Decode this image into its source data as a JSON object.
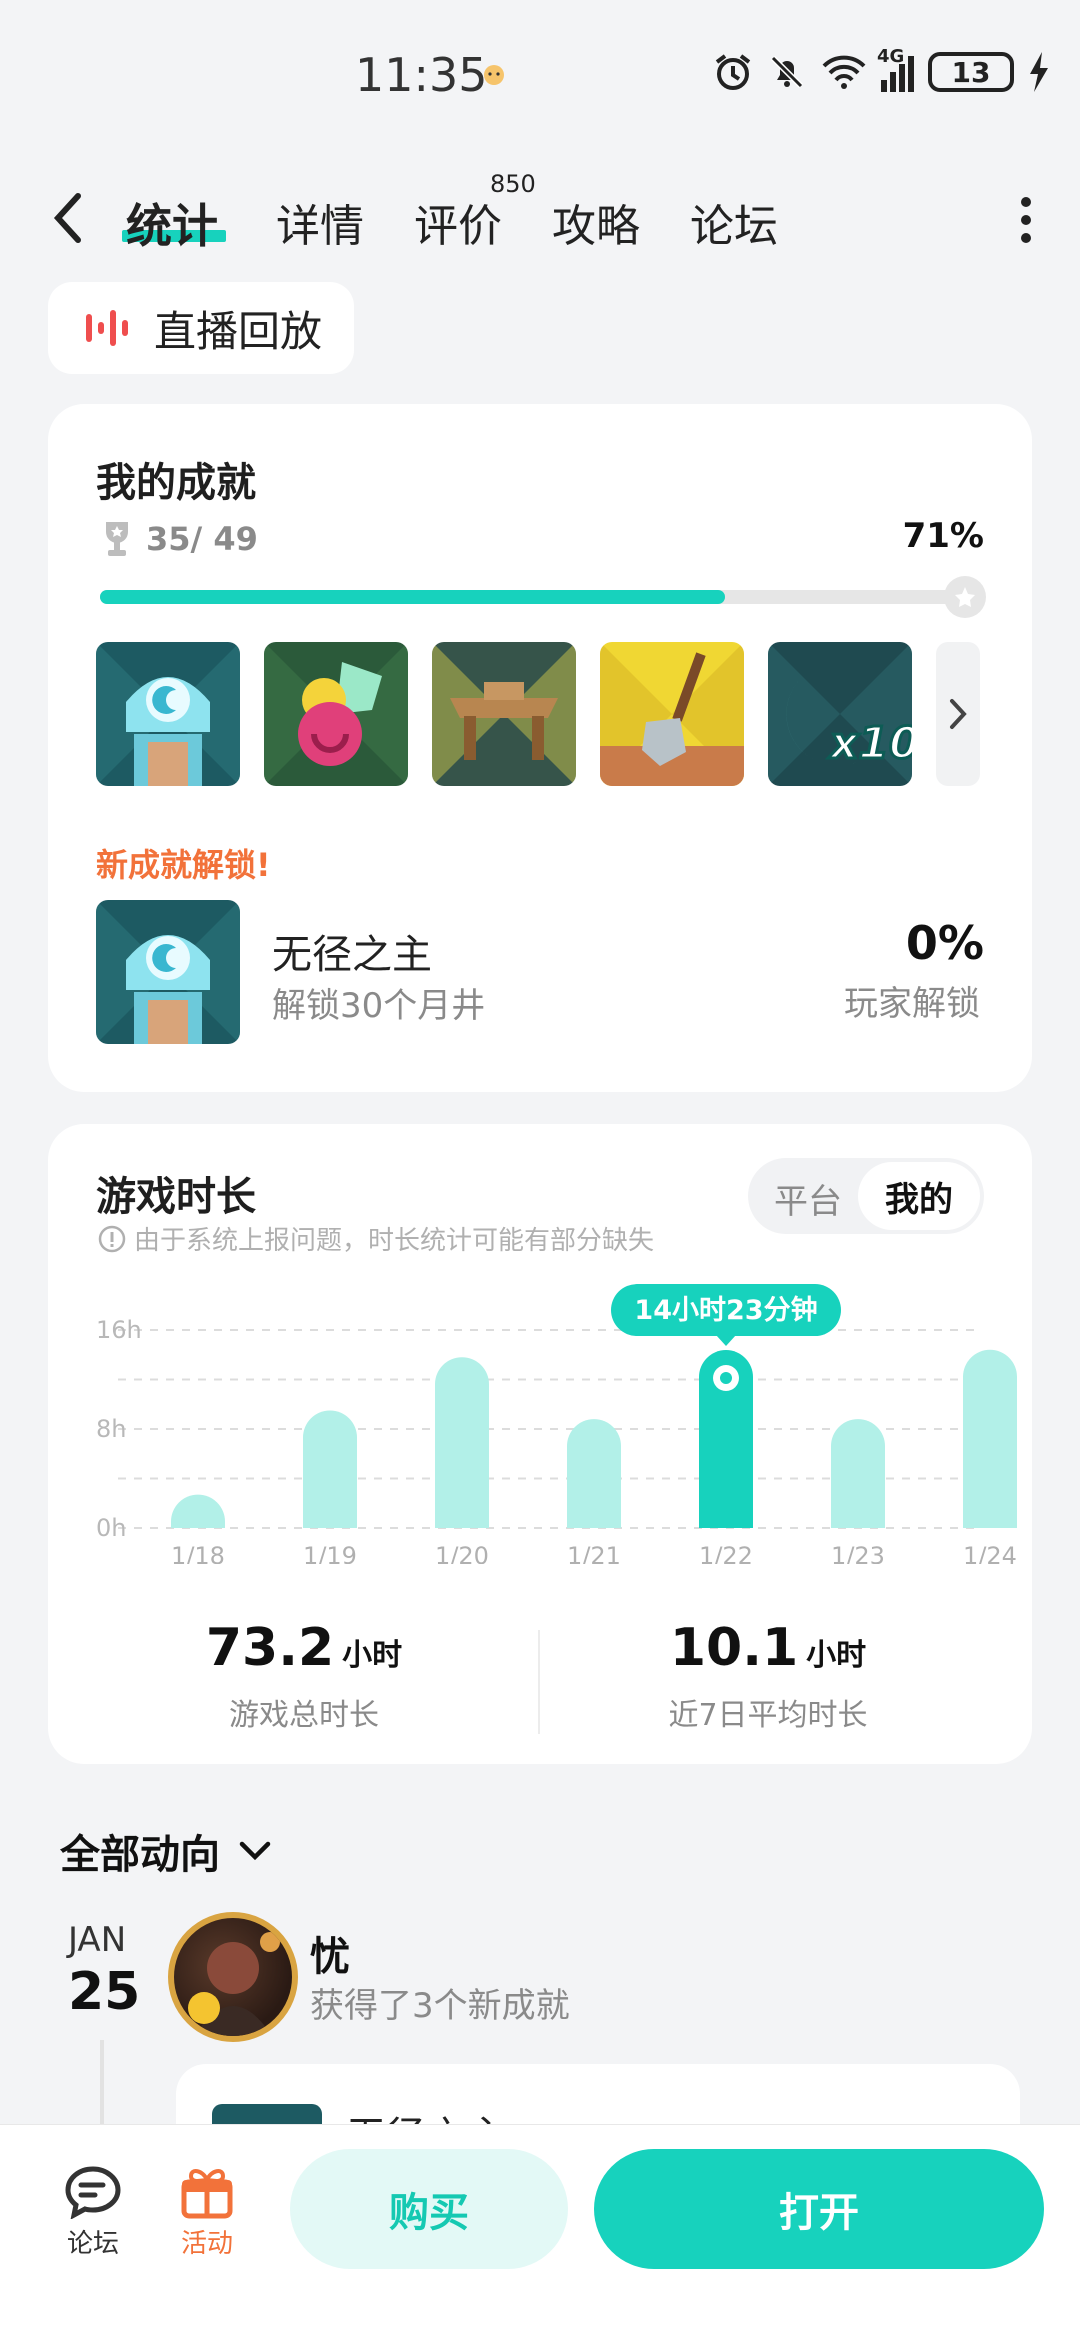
{
  "status": {
    "time": "11:35",
    "network": "4G",
    "battery": "13"
  },
  "nav": {
    "tabs": [
      {
        "label": "统计"
      },
      {
        "label": "详情"
      },
      {
        "label": "评价",
        "badge": "850"
      },
      {
        "label": "攻略"
      },
      {
        "label": "论坛"
      }
    ]
  },
  "live_replay": {
    "label": "直播回放"
  },
  "achievements": {
    "title": "我的成就",
    "count": "35/ 49",
    "percent": "71%",
    "progress_fraction": 0.71,
    "new_label": "新成就解锁!",
    "new_item": {
      "name": "无径之主",
      "desc": "解锁30个月井",
      "percent": "0%",
      "percent_label": "玩家解锁"
    }
  },
  "playtime": {
    "title": "游戏时长",
    "toggle": {
      "off": "平台",
      "on": "我的"
    },
    "note": "由于系统上报问题，时长统计可能有部分缺失",
    "total_value": "73.2",
    "total_unit": "小时",
    "total_label": "游戏总时长",
    "avg_value": "10.1",
    "avg_unit": "小时",
    "avg_label": "近7日平均时长"
  },
  "chart_data": {
    "type": "bar",
    "categories": [
      "1/18",
      "1/19",
      "1/20",
      "1/21",
      "1/22",
      "1/23",
      "1/24"
    ],
    "values": [
      2.7,
      9.5,
      13.8,
      8.8,
      14.38,
      8.8,
      14.4
    ],
    "highlight_index": 4,
    "tooltip": "14小时23分钟",
    "yticks": [
      "0h",
      "8h",
      "16h"
    ],
    "ylim": [
      0,
      16
    ],
    "grid": true,
    "colors": {
      "bar": "#b2f0e8",
      "highlight": "#17d2bd"
    }
  },
  "feed": {
    "title": "全部动向",
    "month": "JAN",
    "day": "25",
    "user": "忧",
    "action": "获得了3个新成就",
    "card_name": "无径之主"
  },
  "bottom": {
    "forum": "论坛",
    "activity": "活动",
    "buy": "购买",
    "open": "打开"
  },
  "colors": {
    "accent": "#17d2bd",
    "orange": "#f2723a"
  }
}
